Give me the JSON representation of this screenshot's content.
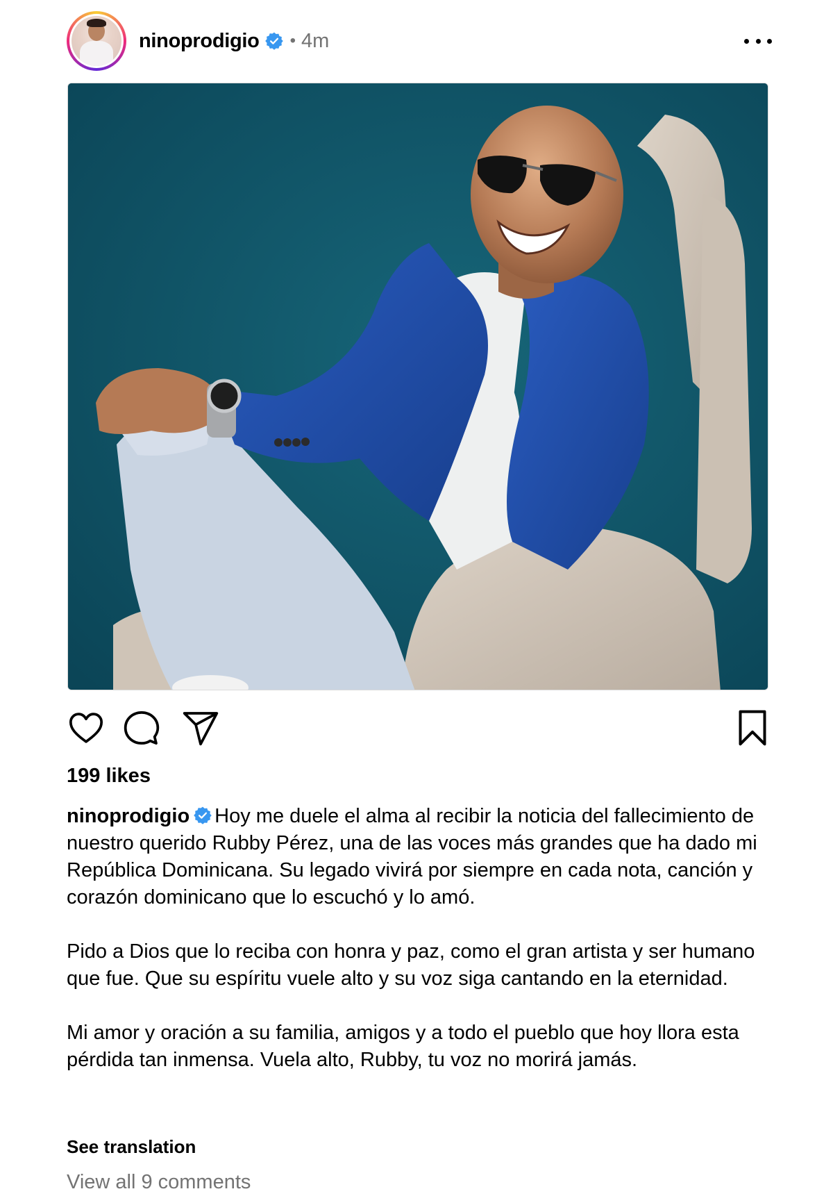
{
  "post": {
    "username": "ninoprodigio",
    "separator": "•",
    "time": "4m",
    "likes": "199 likes",
    "caption": {
      "username": "ninoprodigio",
      "paragraphs": [
        "Hoy me duele el alma al recibir la noticia del fallecimiento de nuestro querido Rubby Pérez, una de las voces más grandes que ha dado mi República Dominicana. Su legado vivirá por siempre en cada nota, canción y corazón dominicano que lo escuchó y lo amó.",
        "Pido a Dios que lo reciba con honra y paz, como el gran artista y ser humano que fue. Que su espíritu vuele alto y su voz siga cantando en la eternidad.",
        "Mi amor y oración a su familia, amigos y a todo el pueblo que hoy llora esta pérdida tan inmensa. Vuela alto, Rubby, tu voz no morirá jamás."
      ]
    },
    "see_translation": "See translation",
    "view_comments": "View all 9 comments"
  },
  "icons": {
    "avatar": "profile-photo",
    "verified": "verified-badge-icon",
    "more": "more-options-icon",
    "like": "heart-icon",
    "comment": "comment-icon",
    "share": "paper-plane-icon",
    "save": "bookmark-icon"
  },
  "colors": {
    "verified_blue": "#3897f0",
    "secondary_text": "#737373",
    "photo_background": "#0d5366",
    "jacket": "#1f4ea8"
  }
}
